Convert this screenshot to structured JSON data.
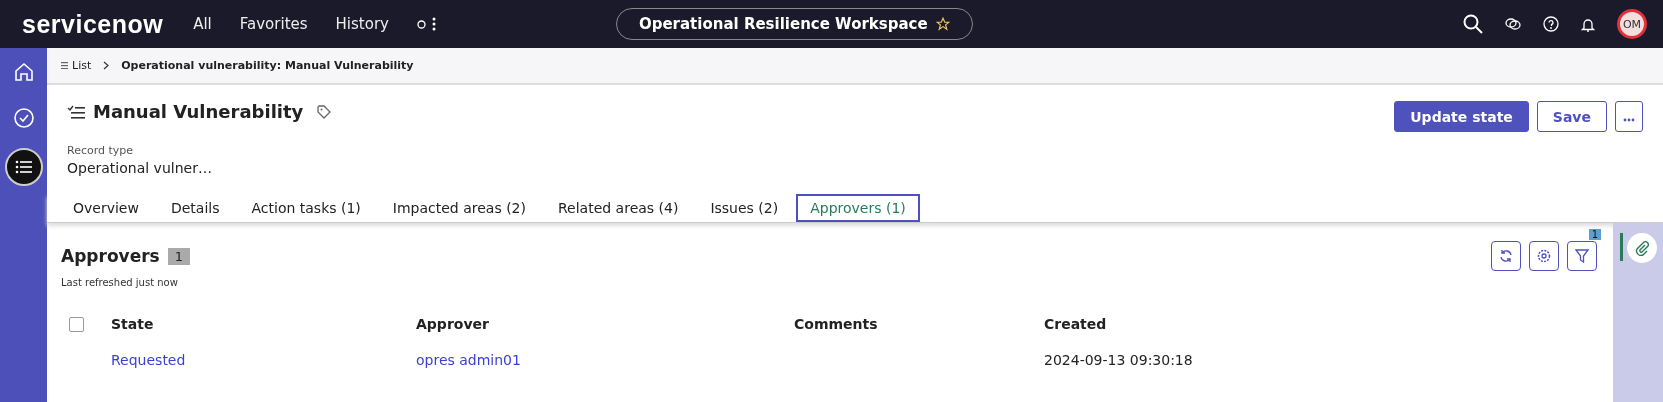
{
  "top_bar": {
    "logo": "servicenow",
    "nav": [
      "All",
      "Favorites",
      "History"
    ],
    "workspace": "Operational Resilience Workspace",
    "avatar": "OM"
  },
  "breadcrumb": {
    "list": "List",
    "current": "Operational vulnerability: Manual Vulnerability"
  },
  "record": {
    "title": "Manual Vulnerability",
    "field_label": "Record type",
    "field_value": "Operational vulner…"
  },
  "actions": [
    "Update state",
    "Save"
  ],
  "tabs": [
    {
      "label": "Overview",
      "selected": false
    },
    {
      "label": "Details",
      "selected": false
    },
    {
      "label": "Action tasks (1)",
      "selected": false
    },
    {
      "label": "Impacted areas (2)",
      "selected": false
    },
    {
      "label": "Related areas (4)",
      "selected": false
    },
    {
      "label": "Issues (2)",
      "selected": false
    },
    {
      "label": "Approvers (1)",
      "selected": true
    }
  ],
  "list": {
    "title": "Approvers",
    "count": "1",
    "refreshed": "Last refreshed just now",
    "filter_badge": "1",
    "columns": [
      "State",
      "Approver",
      "Comments",
      "Created"
    ],
    "select_all_checked": false,
    "rows": [
      {
        "cells": [
          "Requested",
          "opres admin01",
          "",
          "2024-09-13 09:30:18"
        ]
      }
    ]
  }
}
